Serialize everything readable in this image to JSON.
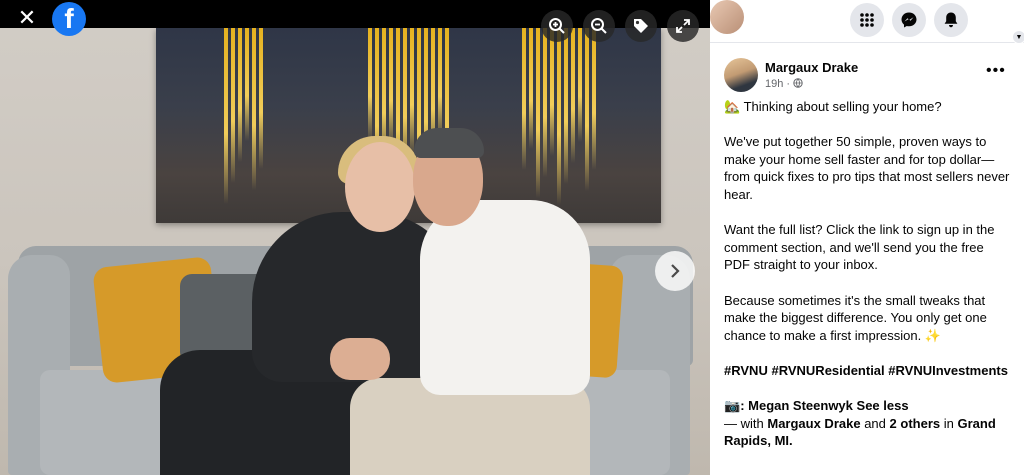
{
  "viewer": {
    "close_glyph": "✕",
    "logo_letter": "f",
    "controls": {
      "zoom_in": "zoom-in-icon",
      "zoom_out": "zoom-out-icon",
      "tag": "tag-icon",
      "expand": "expand-icon",
      "next": "chevron-right-icon"
    }
  },
  "nav": {
    "menu": "grid-menu-icon",
    "messenger": "messenger-icon",
    "notifications": "bell-icon",
    "profile": "profile-avatar"
  },
  "post": {
    "author": "Margaux Drake",
    "time": "19h",
    "audience_icon": "globe-icon",
    "more_glyph": "•••",
    "emoji_house": "🏡",
    "line1": "Thinking about selling your home?",
    "para2": "We've put together 50 simple, proven ways to make your home sell faster and for top dollar—from quick fixes to pro tips that most sellers never hear.",
    "para3": "Want the full list? Click the link to sign up in the comment section, and we'll send you the free PDF straight to your inbox.",
    "para4": "Because sometimes it's the small tweaks that make the biggest difference. You only get one chance to make a first impression.",
    "sparkle": "✨",
    "hashtags": [
      "#RVNU",
      "#RVNUResidential",
      "#RVNUInvestments"
    ],
    "camera": "📷",
    "credit_name": "Megan Steenwyk",
    "see_less": "See less",
    "with_prefix": "— with",
    "with_name": "Margaux Drake",
    "and_text": "and",
    "others": "2 others",
    "in_text": "in",
    "location": "Grand Rapids, MI."
  },
  "colors": {
    "fb_blue": "#1877f2",
    "panel_bg": "#ffffff",
    "button_bg": "#e4e6eb",
    "secondary_text": "#65676b"
  }
}
